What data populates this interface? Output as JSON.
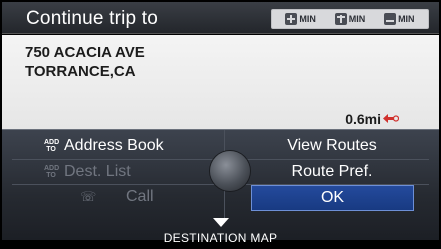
{
  "header": {
    "title": "Continue trip to",
    "route_options": [
      {
        "icon": "highway-icon",
        "label": "MIN"
      },
      {
        "icon": "toll-road-icon",
        "label": "MIN"
      },
      {
        "icon": "ferry-icon",
        "label": "MIN"
      }
    ]
  },
  "destination": {
    "street": "750 ACACIA AVE",
    "city": "TORRANCE,CA",
    "distance": "0.6mi"
  },
  "menu": {
    "address_book": {
      "icon_text": "ADD TO",
      "label": "Address Book"
    },
    "dest_list": {
      "icon_text": "ADD TO",
      "label": "Dest. List"
    },
    "call": {
      "label": "Call"
    },
    "view_routes": "View Routes",
    "route_pref": "Route Pref.",
    "ok": "OK"
  },
  "footer": {
    "label": "DESTINATION MAP"
  }
}
